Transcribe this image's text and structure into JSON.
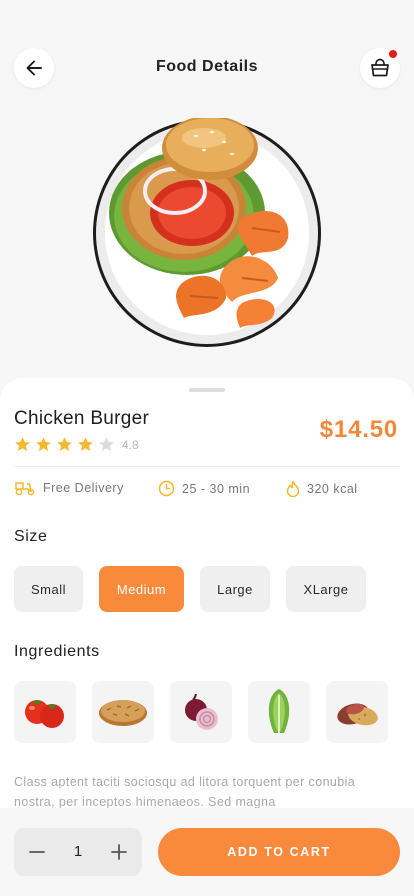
{
  "header": {
    "title": "Food Details",
    "back_icon": "arrow-left-icon",
    "cart_icon": "shopping-basket-icon",
    "cart_has_notification": true
  },
  "product": {
    "name": "Chicken Burger",
    "price": "$14.50",
    "rating": "4.8",
    "stars_filled": 4,
    "stars_total": 5
  },
  "info": {
    "delivery": "Free Delivery",
    "time": "25 - 30 min",
    "calories": "320 kcal"
  },
  "size": {
    "title": "Size",
    "options": [
      "Small",
      "Medium",
      "Large",
      "XLarge"
    ],
    "selected": "Medium"
  },
  "ingredients": {
    "title": "Ingredients",
    "items": [
      "tomato-icon",
      "chicken-patty-icon",
      "onion-icon",
      "lettuce-icon",
      "potato-icon"
    ]
  },
  "description": "Class aptent taciti sociosqu ad litora torquent per conubia nostra, per inceptos himenaeos. Sed magna",
  "cart": {
    "quantity": "1",
    "add_label": "ADD TO CART"
  },
  "colors": {
    "accent": "#f98a3c",
    "price": "#f4883a",
    "star": "#f5b82e",
    "notification": "#e81919"
  }
}
